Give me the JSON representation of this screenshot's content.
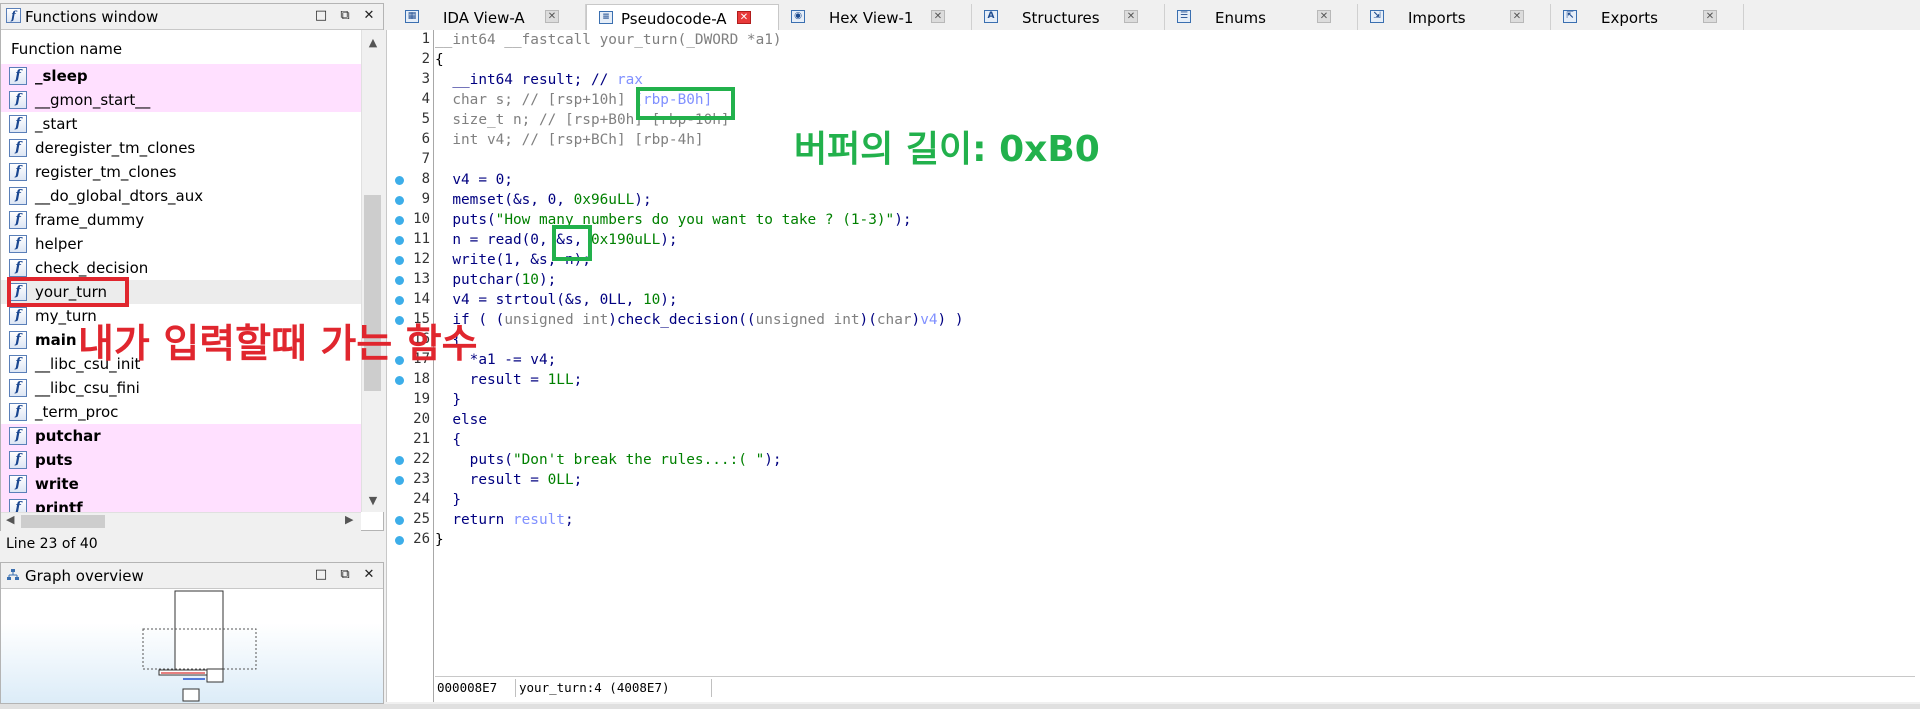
{
  "functions_window": {
    "title": "Functions window",
    "column_header": "Function name",
    "items": [
      {
        "name": "_sleep",
        "bold": true,
        "pink": true
      },
      {
        "name": "__gmon_start__",
        "bold": false,
        "pink": true
      },
      {
        "name": "_start",
        "bold": false,
        "pink": false
      },
      {
        "name": "deregister_tm_clones",
        "bold": false,
        "pink": false
      },
      {
        "name": "register_tm_clones",
        "bold": false,
        "pink": false
      },
      {
        "name": "__do_global_dtors_aux",
        "bold": false,
        "pink": false
      },
      {
        "name": "frame_dummy",
        "bold": false,
        "pink": false
      },
      {
        "name": "helper",
        "bold": false,
        "pink": false
      },
      {
        "name": "check_decision",
        "bold": false,
        "pink": false
      },
      {
        "name": "your_turn",
        "bold": false,
        "pink": false,
        "selected": true
      },
      {
        "name": "my_turn",
        "bold": false,
        "pink": false
      },
      {
        "name": "main",
        "bold": true,
        "pink": false
      },
      {
        "name": "__libc_csu_init",
        "bold": false,
        "pink": false
      },
      {
        "name": "__libc_csu_fini",
        "bold": false,
        "pink": false
      },
      {
        "name": "_term_proc",
        "bold": false,
        "pink": false
      },
      {
        "name": "putchar",
        "bold": true,
        "pink": true
      },
      {
        "name": "puts",
        "bold": true,
        "pink": true
      },
      {
        "name": "write",
        "bold": true,
        "pink": true
      },
      {
        "name": "printf",
        "bold": true,
        "pink": true
      }
    ],
    "status": "Line 23 of 40",
    "function_icon_glyph": "f",
    "pink_color": "#ffe0ff"
  },
  "graph_overview": {
    "title": "Graph overview"
  },
  "panel_buttons": {
    "float": "□",
    "restore": "⧉",
    "close": "✕"
  },
  "tabs": [
    {
      "label": "IDA View-A",
      "icon": "graph-icon",
      "active": false
    },
    {
      "label": "Pseudocode-A",
      "icon": "pseudocode-icon",
      "active": true
    },
    {
      "label": "Hex View-1",
      "icon": "hex-icon",
      "active": false
    },
    {
      "label": "Structures",
      "icon": "structures-icon",
      "active": false
    },
    {
      "label": "Enums",
      "icon": "enums-icon",
      "active": false
    },
    {
      "label": "Imports",
      "icon": "imports-icon",
      "active": false
    },
    {
      "label": "Exports",
      "icon": "exports-icon",
      "active": false
    }
  ],
  "code": {
    "lines": [
      {
        "num": "1",
        "dot": false
      },
      {
        "num": "2",
        "dot": false
      },
      {
        "num": "3",
        "dot": false
      },
      {
        "num": "4",
        "dot": false
      },
      {
        "num": "5",
        "dot": false
      },
      {
        "num": "6",
        "dot": false
      },
      {
        "num": "7",
        "dot": false
      },
      {
        "num": "8",
        "dot": true
      },
      {
        "num": "9",
        "dot": true
      },
      {
        "num": "10",
        "dot": true
      },
      {
        "num": "11",
        "dot": true
      },
      {
        "num": "12",
        "dot": true
      },
      {
        "num": "13",
        "dot": true
      },
      {
        "num": "14",
        "dot": true
      },
      {
        "num": "15",
        "dot": true
      },
      {
        "num": "16",
        "dot": false
      },
      {
        "num": "17",
        "dot": true
      },
      {
        "num": "18",
        "dot": true
      },
      {
        "num": "19",
        "dot": false
      },
      {
        "num": "20",
        "dot": false
      },
      {
        "num": "21",
        "dot": false
      },
      {
        "num": "22",
        "dot": true
      },
      {
        "num": "23",
        "dot": true
      },
      {
        "num": "24",
        "dot": false
      },
      {
        "num": "25",
        "dot": true
      },
      {
        "num": "26",
        "dot": true
      }
    ],
    "text": {
      "l1a": "__int64 __fastcall your_turn(_DWORD *a1)",
      "l2": "{",
      "l3a": "  __int64 result; // ",
      "l3b": "rax",
      "l4a": "  char s; // [rsp+10h] ",
      "l4b": "[rbp-B0h]",
      "l5a": "  size_t n; // [rsp+B0h] [rbp-10h]",
      "l6a": "  int v4; // [rsp+BCh] [rbp-4h]",
      "l8": "  v4 = 0;",
      "l9a": "  memset(&s, 0, ",
      "l9b": "0x96uLL",
      "l9c": ");",
      "l10a": "  puts(",
      "l10b": "\"How many numbers do you want to take ? (1-3)\"",
      "l10c": ");",
      "l11a": "  n = read(0, ",
      "l11b": "&s",
      "l11c": ", ",
      "l11d": "0x190uLL",
      "l11e": ");",
      "l12a": "  write(1, &s, n);",
      "l13a": "  putchar(",
      "l13b": "10",
      "l13c": ");",
      "l14a": "  v4 = strtoul(&s, 0LL, ",
      "l14b": "10",
      "l14c": ");",
      "l15a": "  if ( (",
      "l15b": "unsigned int",
      "l15c": ")check_decision((",
      "l15d": "unsigned int",
      "l15e": ")(",
      "l15f": "char",
      "l15g": ")",
      "l15h": "v4",
      "l15i": ") )",
      "l16": "  {",
      "l17": "    *a1 -= v4;",
      "l18a": "    result = ",
      "l18b": "1LL",
      "l18c": ";",
      "l19": "  }",
      "l20": "  else",
      "l21": "  {",
      "l22a": "    puts(",
      "l22b": "\"Don't break the rules...:( \"",
      "l22c": ");",
      "l23a": "    result = ",
      "l23b": "0LL",
      "l23c": ";",
      "l24": "  }",
      "l25a": "  return ",
      "l25b": "result",
      "l25c": ";",
      "l26": "}"
    },
    "status_addr": "000008E7",
    "status_pos": "your_turn:4 (4008E7)"
  },
  "annotations": {
    "red_note": "내가 입력할때 가는 함수",
    "green_note": "버퍼의 길이: 0xB0",
    "red_color": "#e0262e",
    "green_color": "#22b14c"
  }
}
